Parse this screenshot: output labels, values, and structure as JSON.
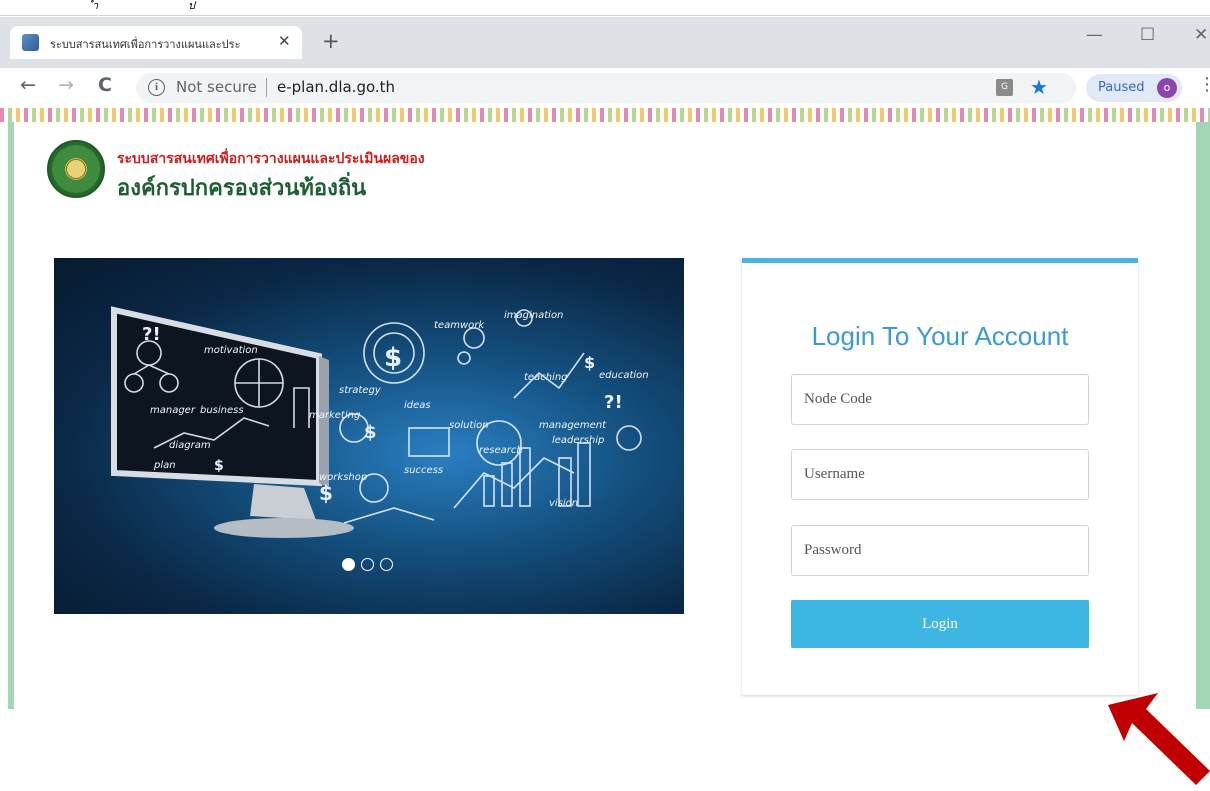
{
  "top_strip": {
    "marks": [
      "ำ",
      "ป"
    ]
  },
  "browser": {
    "tab_title": "ระบบสารสนเทศเพื่อการวางแผนและประ",
    "tab_close": "✕",
    "new_tab": "+",
    "window_controls": {
      "minimize": "—",
      "maximize": "☐",
      "close": "✕"
    },
    "nav": {
      "back": "←",
      "forward": "→",
      "reload": "C"
    },
    "info_icon": "i",
    "security_text": "Not secure",
    "url": "e-plan.dla.go.th",
    "translate_icon": "G",
    "star_icon": "★",
    "paused_label": "Paused",
    "avatar_letter": "o",
    "menu_icon": "⋮"
  },
  "site": {
    "title_line1": "ระบบสารสนเทศเพื่อการวางแผนและประเมินผลของ",
    "title_line2": "องค์กรปกครองส่วนท้องถิ่น"
  },
  "slider": {
    "active_index": 0,
    "count": 3,
    "image_words": [
      "motivation",
      "teamwork",
      "imagination",
      "teaching",
      "education",
      "strategy",
      "ideas",
      "solution",
      "management",
      "marketing",
      "manager",
      "business",
      "research",
      "leadership",
      "success",
      "vision",
      "diagram",
      "plan",
      "workshop"
    ]
  },
  "login": {
    "heading": "Login To Your Account",
    "node_code_placeholder": "Node Code",
    "username_placeholder": "Username",
    "password_placeholder": "Password",
    "button_label": "Login"
  },
  "colors": {
    "accent": "#3eb6e4",
    "heading": "#3a9bd3",
    "brand_red": "#cc1f1f",
    "brand_green": "#1d5e33",
    "annotation_arrow": "#c00000"
  }
}
